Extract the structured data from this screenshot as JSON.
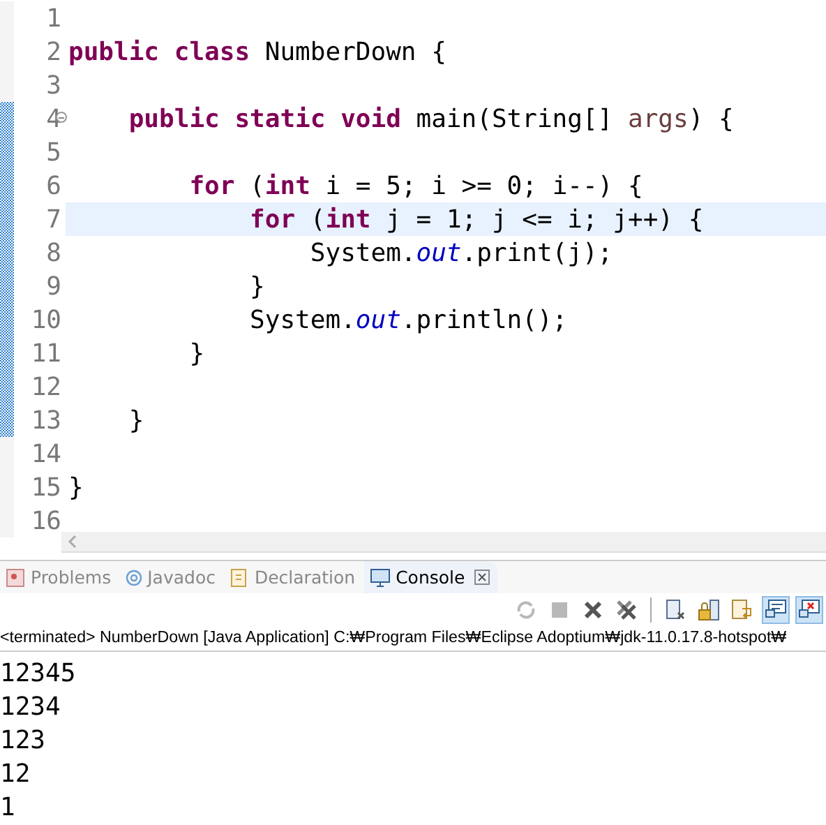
{
  "editor": {
    "lines": [
      {
        "number": "1",
        "current": false,
        "changed": false
      },
      {
        "number": "2",
        "current": false,
        "changed": false,
        "tokens": [
          {
            "text": "public class",
            "kind": "keyword"
          },
          {
            "text": " NumberDown {",
            "kind": "plain"
          }
        ]
      },
      {
        "number": "3",
        "current": false,
        "changed": false
      },
      {
        "number": "4",
        "fold": true,
        "current": false,
        "changed": true,
        "tokens": [
          {
            "text": "    public static void",
            "kind": "keyword"
          },
          {
            "text": " main(String[] ",
            "kind": "plain"
          },
          {
            "text": "args",
            "kind": "param"
          },
          {
            "text": ") {",
            "kind": "plain"
          }
        ]
      },
      {
        "number": "5",
        "current": false,
        "changed": true
      },
      {
        "number": "6",
        "current": false,
        "changed": true,
        "tokens": [
          {
            "text": "        for",
            "kind": "keyword"
          },
          {
            "text": " (",
            "kind": "plain"
          },
          {
            "text": "int",
            "kind": "keyword"
          },
          {
            "text": " i = 5; i >= 0; i--) {",
            "kind": "plain"
          }
        ]
      },
      {
        "number": "7",
        "current": true,
        "changed": true,
        "tokens": [
          {
            "text": "            for",
            "kind": "keyword"
          },
          {
            "text": " (",
            "kind": "plain"
          },
          {
            "text": "int",
            "kind": "keyword"
          },
          {
            "text": " j = 1; j <= i; j++) {",
            "kind": "plain"
          }
        ]
      },
      {
        "number": "8",
        "current": false,
        "changed": true,
        "tokens": [
          {
            "text": "                System.",
            "kind": "plain"
          },
          {
            "text": "out",
            "kind": "field"
          },
          {
            "text": ".print(j);",
            "kind": "plain"
          }
        ]
      },
      {
        "number": "9",
        "current": false,
        "changed": true,
        "tokens": [
          {
            "text": "            }",
            "kind": "plain"
          }
        ]
      },
      {
        "number": "10",
        "current": false,
        "changed": true,
        "tokens": [
          {
            "text": "            System.",
            "kind": "plain"
          },
          {
            "text": "out",
            "kind": "field"
          },
          {
            "text": ".println();",
            "kind": "plain"
          }
        ]
      },
      {
        "number": "11",
        "current": false,
        "changed": true,
        "tokens": [
          {
            "text": "        }",
            "kind": "plain"
          }
        ]
      },
      {
        "number": "12",
        "current": false,
        "changed": true
      },
      {
        "number": "13",
        "current": false,
        "changed": true,
        "tokens": [
          {
            "text": "    }",
            "kind": "plain"
          }
        ]
      },
      {
        "number": "14",
        "current": false,
        "changed": false
      },
      {
        "number": "15",
        "current": false,
        "changed": false,
        "tokens": [
          {
            "text": "}",
            "kind": "plain"
          }
        ]
      },
      {
        "number": "16",
        "current": false,
        "changed": false
      }
    ]
  },
  "tabs": [
    {
      "label": "Problems",
      "kind": "problems",
      "selected": false
    },
    {
      "label": "Javadoc",
      "kind": "javadoc",
      "selected": false
    },
    {
      "label": "Declaration",
      "kind": "declaration",
      "selected": false
    },
    {
      "label": "Console",
      "kind": "console",
      "selected": true,
      "closable": true
    }
  ],
  "toolbar": [
    {
      "kind": "relaunch",
      "disabled": true,
      "on": false
    },
    {
      "kind": "stop",
      "disabled": true,
      "on": false
    },
    {
      "kind": "remove",
      "disabled": false,
      "on": false
    },
    {
      "kind": "remove-all",
      "disabled": false,
      "on": false
    },
    {
      "kind": "separator"
    },
    {
      "kind": "clear",
      "disabled": false,
      "on": false
    },
    {
      "kind": "scroll-lock",
      "disabled": false,
      "on": false
    },
    {
      "kind": "word-wrap",
      "disabled": false,
      "on": false
    },
    {
      "kind": "stdout",
      "disabled": false,
      "on": true
    },
    {
      "kind": "stderr",
      "disabled": false,
      "on": true
    }
  ],
  "console": {
    "header": "<terminated> NumberDown [Java Application] C:₩Program Files₩Eclipse Adoptium₩jdk-11.0.17.8-hotspot₩",
    "output": [
      "12345",
      "1234",
      "123",
      "12",
      "1"
    ]
  }
}
